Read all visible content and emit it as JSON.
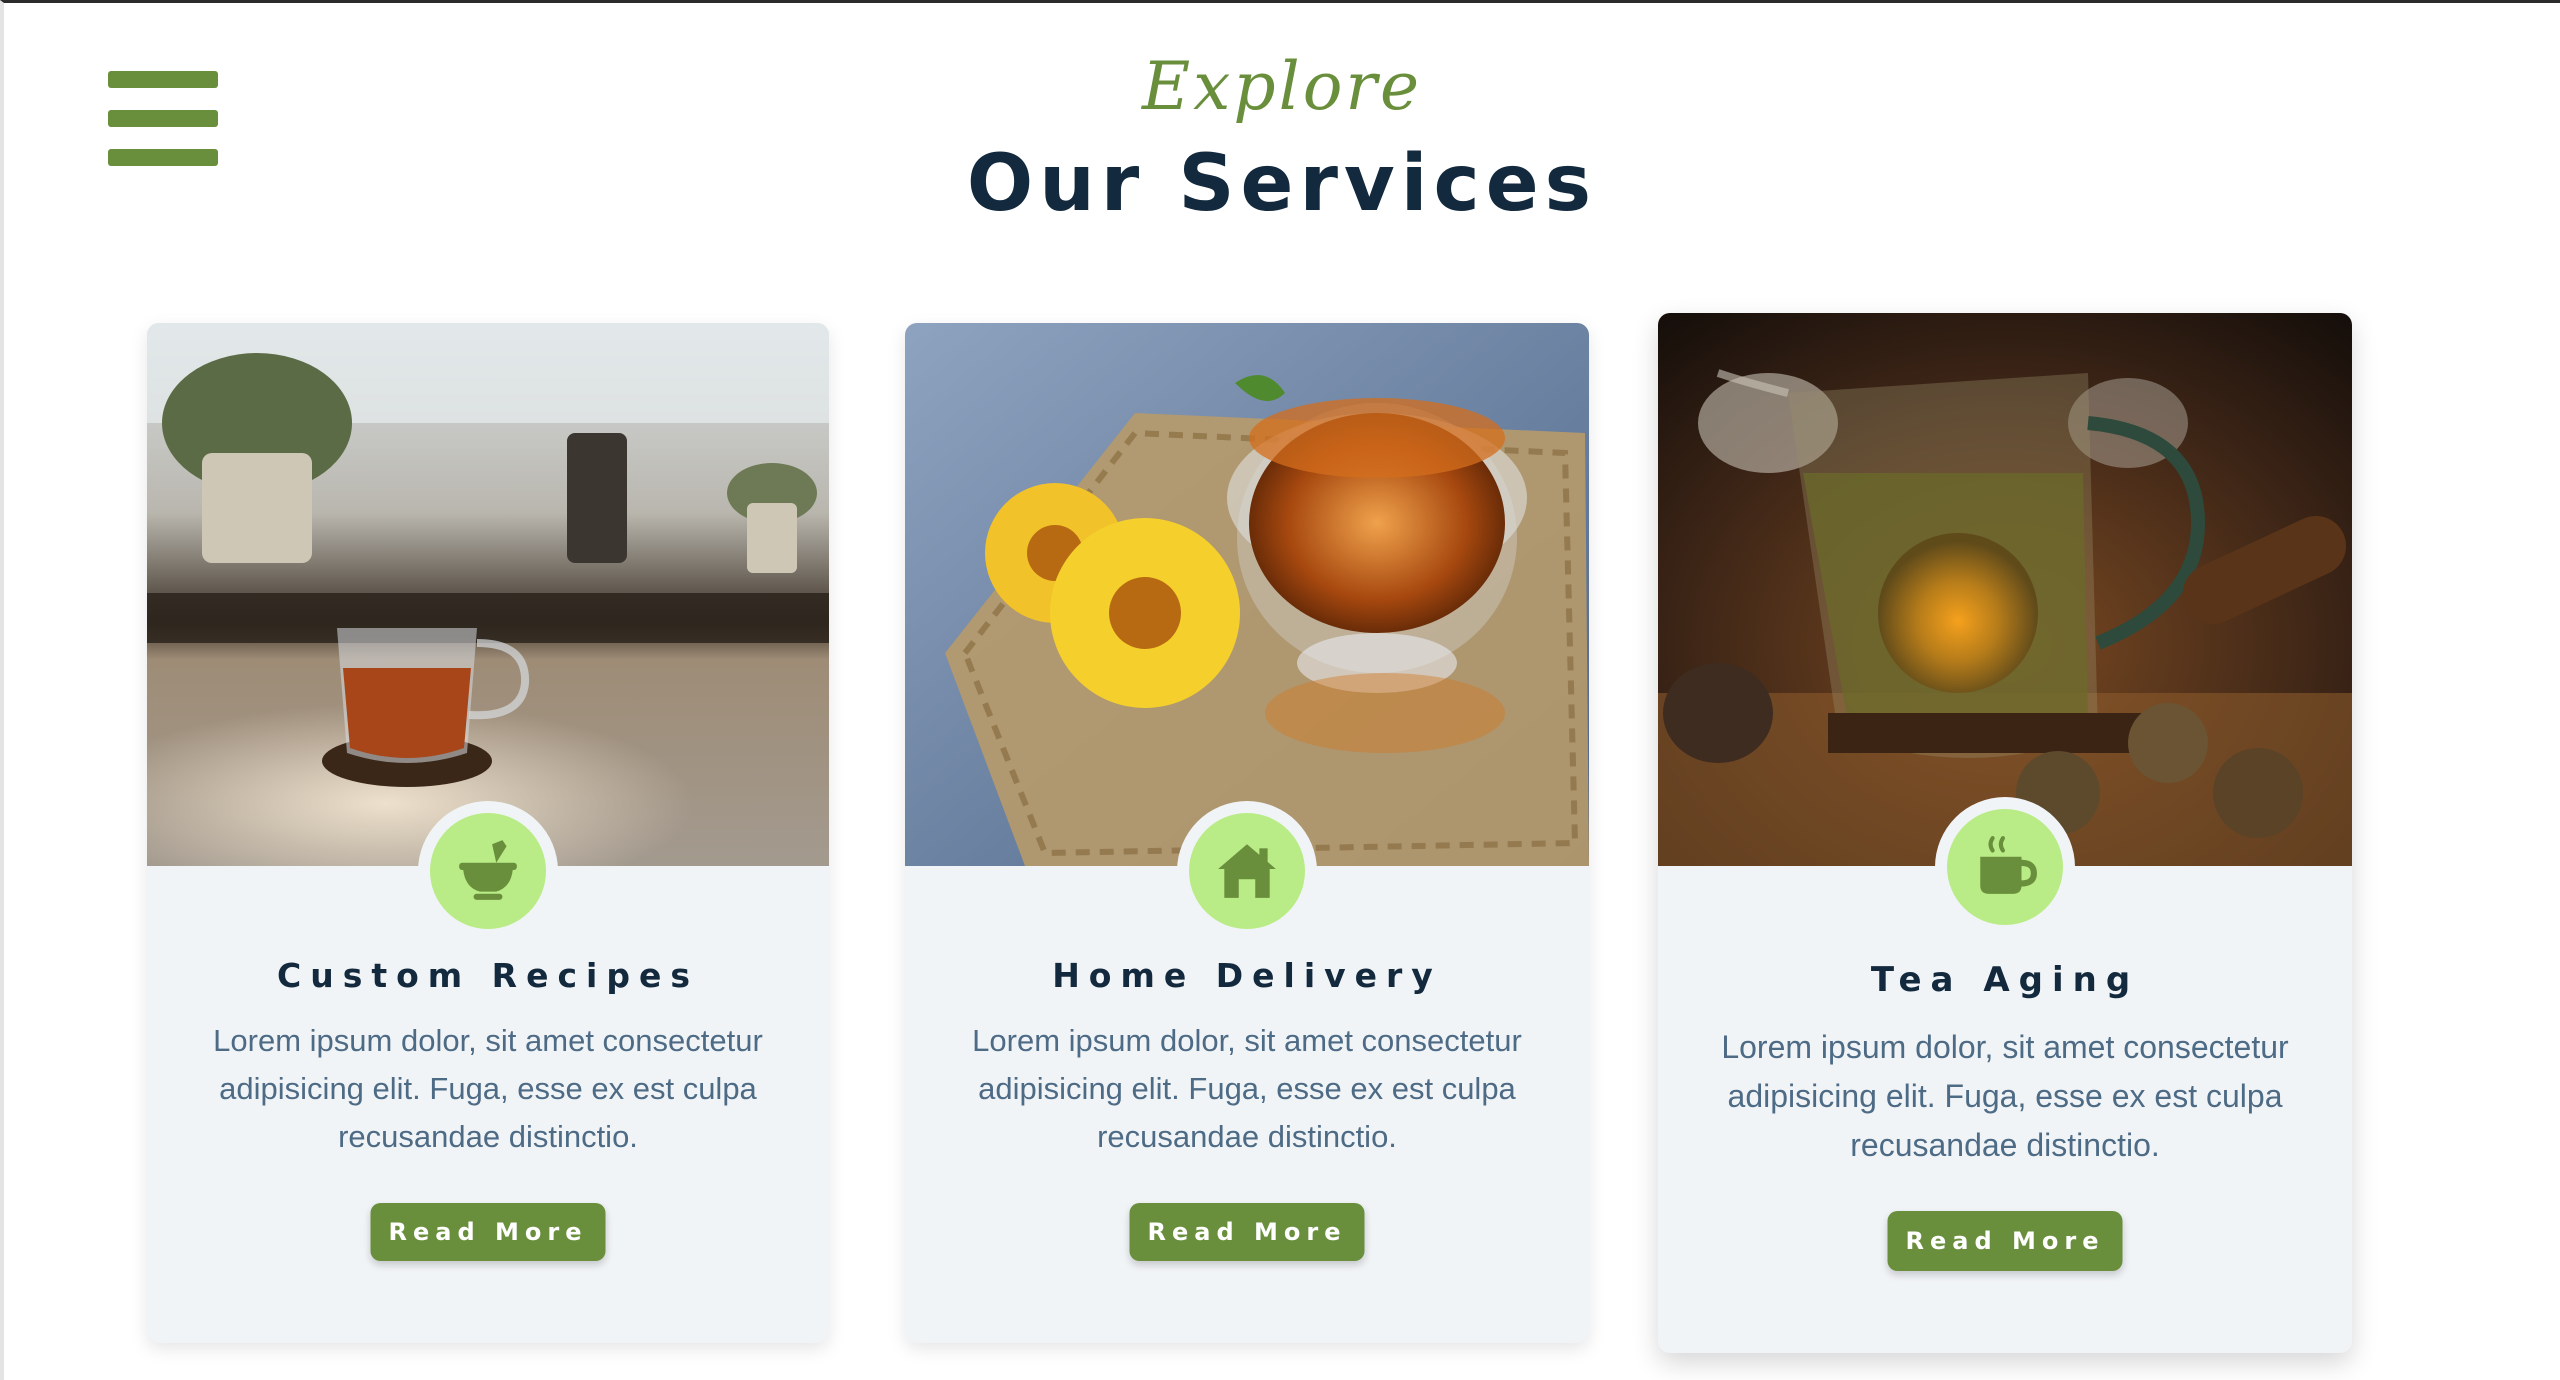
{
  "header": {
    "menu_icon": "hamburger-menu-icon",
    "kicker": "Explore",
    "title": "Our Services"
  },
  "services": [
    {
      "title": "Custom Recipes",
      "icon": "mortar-pestle-icon",
      "image": "tea-cup-on-windowsill-photo",
      "text": "Lorem ipsum dolor, sit amet consectetur adipisicing elit. Fuga, esse ex est culpa recusandae distinctio.",
      "button": "Read More"
    },
    {
      "title": "Home Delivery",
      "icon": "home-icon",
      "image": "tea-glass-with-flowers-photo",
      "text": "Lorem ipsum dolor, sit amet consectetur adipisicing elit. Fuga, esse ex est culpa recusandae distinctio.",
      "button": "Read More"
    },
    {
      "title": "Tea Aging",
      "icon": "coffee-cup-icon",
      "image": "flowering-tea-pot-photo",
      "text": "Lorem ipsum dolor, sit amet consectetur adipisicing elit. Fuga, esse ex est culpa recusandae distinctio.",
      "button": "Read More"
    }
  ],
  "colors": {
    "accent_green": "#6a8f3c",
    "icon_disc": "#b9ec86",
    "title_navy": "#13293d",
    "body_text": "#4e6b86",
    "card_bg": "#f1f4f7"
  }
}
